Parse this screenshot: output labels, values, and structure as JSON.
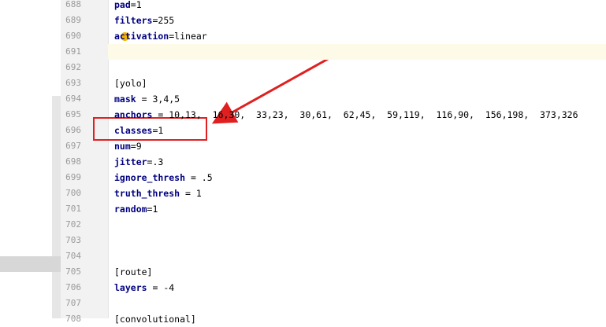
{
  "editor": {
    "lines": [
      {
        "num": "688",
        "key": "pad",
        "rest": "=1"
      },
      {
        "num": "689",
        "key": "filters",
        "rest": "=255"
      },
      {
        "num": "690",
        "key": "activation",
        "rest": "=linear"
      },
      {
        "num": "691",
        "key": "",
        "rest": "",
        "current": true
      },
      {
        "num": "692",
        "key": "",
        "rest": ""
      },
      {
        "num": "693",
        "section": "[yolo]"
      },
      {
        "num": "694",
        "key": "mask",
        "rest": " = 3,4,5"
      },
      {
        "num": "695",
        "key": "anchors",
        "rest": " = 10,13,  16,30,  33,23,  30,61,  62,45,  59,119,  116,90,  156,198,  373,326"
      },
      {
        "num": "696",
        "key": "classes",
        "rest": "=1"
      },
      {
        "num": "697",
        "key": "num",
        "rest": "=9"
      },
      {
        "num": "698",
        "key": "jitter",
        "rest": "=.3"
      },
      {
        "num": "699",
        "key": "ignore_thresh",
        "rest": " = .5"
      },
      {
        "num": "700",
        "key": "truth_thresh",
        "rest": " = 1"
      },
      {
        "num": "701",
        "key": "random",
        "rest": "=1"
      },
      {
        "num": "702",
        "key": "",
        "rest": ""
      },
      {
        "num": "703",
        "key": "",
        "rest": ""
      },
      {
        "num": "704",
        "key": "",
        "rest": ""
      },
      {
        "num": "705",
        "section": "[route]"
      },
      {
        "num": "706",
        "key": "layers",
        "rest": " = -4"
      },
      {
        "num": "707",
        "key": "",
        "rest": ""
      },
      {
        "num": "708",
        "section": "[convolutional]"
      }
    ]
  },
  "annotation": {
    "arrow_color": "#e02020",
    "box_color": "#e02020"
  },
  "icons": {
    "bulb": "lightbulb-icon"
  }
}
